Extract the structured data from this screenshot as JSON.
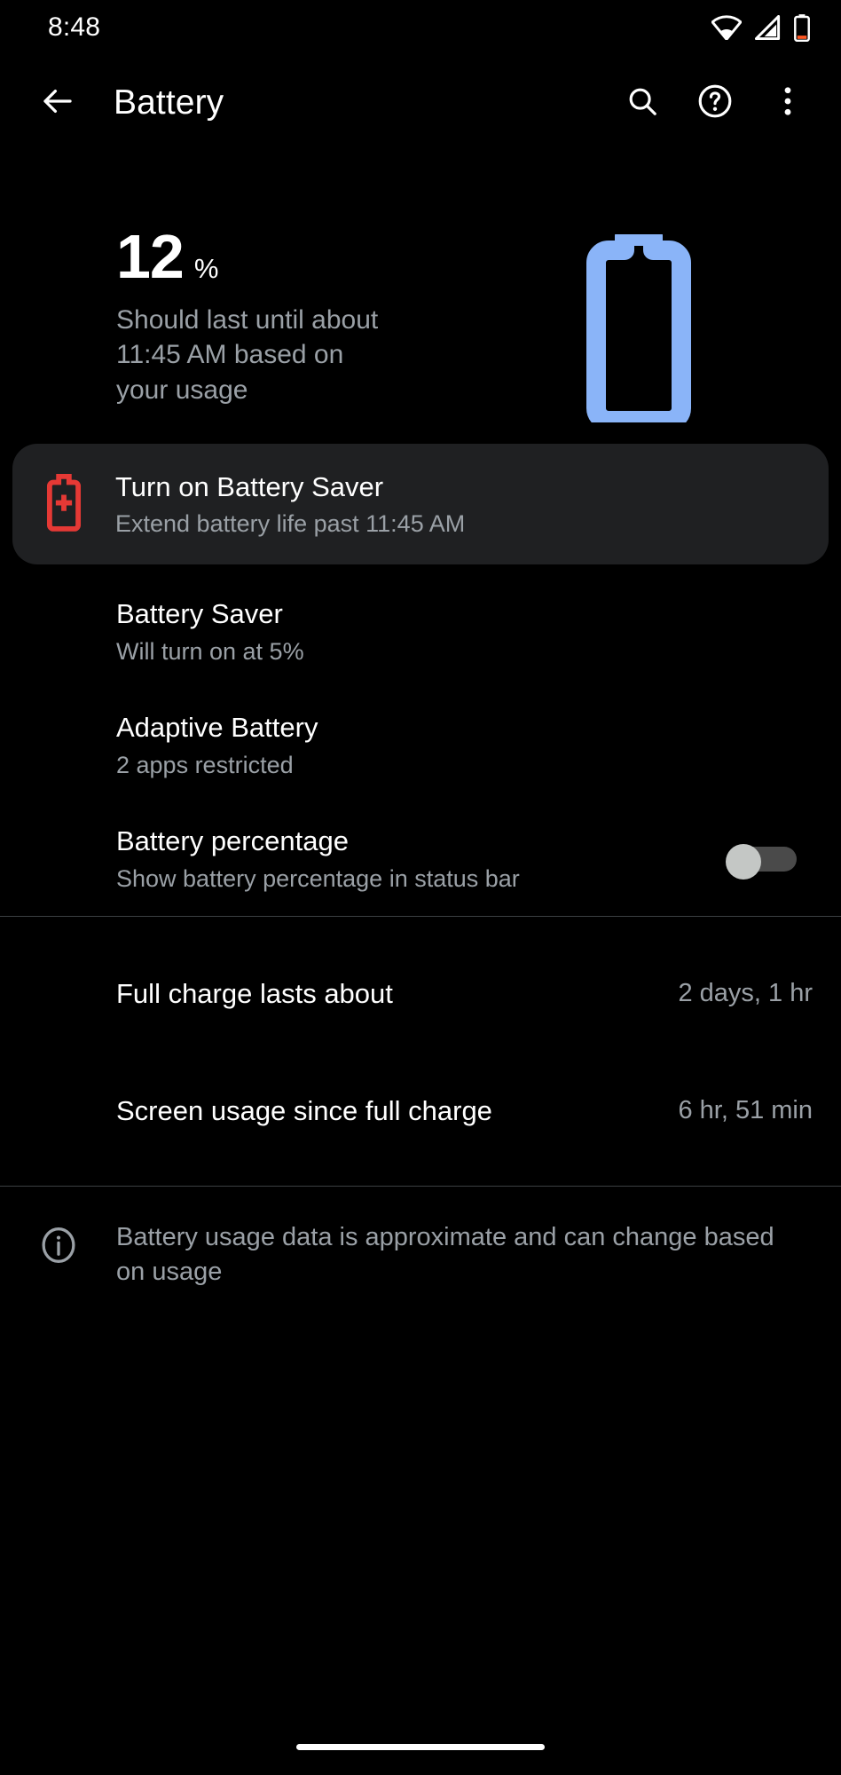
{
  "status_bar": {
    "time": "8:48",
    "icons": [
      "wifi-icon",
      "cellular-signal-icon",
      "battery-low-icon"
    ]
  },
  "app_bar": {
    "back_icon": "arrow-back-icon",
    "title": "Battery",
    "actions": [
      {
        "name": "search-icon",
        "label": "Search"
      },
      {
        "name": "help-icon",
        "label": "Help"
      },
      {
        "name": "overflow-menu-icon",
        "label": "More options"
      }
    ]
  },
  "summary": {
    "percent_number": "12",
    "percent_sign": "%",
    "estimate": "Should last until about 11:45 AM based on your usage",
    "battery_icon": "battery-outline-icon",
    "battery_icon_color": "#8ab4f8"
  },
  "suggestion_card": {
    "icon": "battery-saver-plus-icon",
    "icon_color": "#e53935",
    "title": "Turn on Battery Saver",
    "subtitle": "Extend battery life past 11:45 AM",
    "background": "#1f2022"
  },
  "preferences": [
    {
      "title": "Battery Saver",
      "subtitle": "Will turn on at 5%",
      "has_switch": false
    },
    {
      "title": "Adaptive Battery",
      "subtitle": "2 apps restricted",
      "has_switch": false
    },
    {
      "title": "Battery percentage",
      "subtitle": "Show battery percentage in status bar",
      "has_switch": true,
      "switch_on": false
    }
  ],
  "stats": [
    {
      "label": "Full charge lasts about",
      "value": "2 days, 1 hr"
    },
    {
      "label": "Screen usage since full charge",
      "value": "6 hr, 51 min"
    }
  ],
  "footer": {
    "icon": "info-icon",
    "note": "Battery usage data is approximate and can change based on usage"
  },
  "nav_bar": {
    "gesture_pill": "home-gesture-pill"
  },
  "theme": {
    "background": "#000000",
    "primary_text": "#ffffff",
    "secondary_text": "#9aa0a6",
    "accent": "#8ab4f8",
    "divider": "#3c4043"
  }
}
